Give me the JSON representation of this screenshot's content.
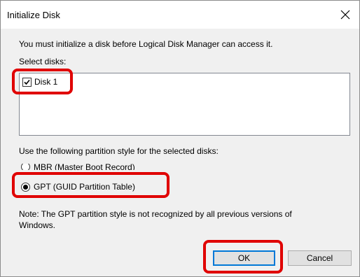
{
  "window": {
    "title": "Initialize Disk",
    "close_glyph": "✕"
  },
  "intro_text": "You must initialize a disk before Logical Disk Manager can access it.",
  "select_disks_label": "Select disks:",
  "disks": [
    {
      "label": "Disk 1",
      "checked": true
    }
  ],
  "partition_style_label": "Use the following partition style for the selected disks:",
  "partition_options": [
    {
      "label": "MBR (Master Boot Record)",
      "selected": false
    },
    {
      "label": "GPT (GUID Partition Table)",
      "selected": true
    }
  ],
  "note_line1": "Note: The GPT partition style is not recognized by all previous versions of",
  "note_line2": "Windows.",
  "buttons": {
    "ok": "OK",
    "cancel": "Cancel"
  },
  "colors": {
    "highlight": "#e00000",
    "default_button_border": "#0078d7"
  },
  "icons": {
    "close": "close-icon",
    "checkbox": "checkbox-checked-icon",
    "radio_selected": "radio-selected-icon",
    "radio_unselected": "radio-unselected-icon"
  }
}
